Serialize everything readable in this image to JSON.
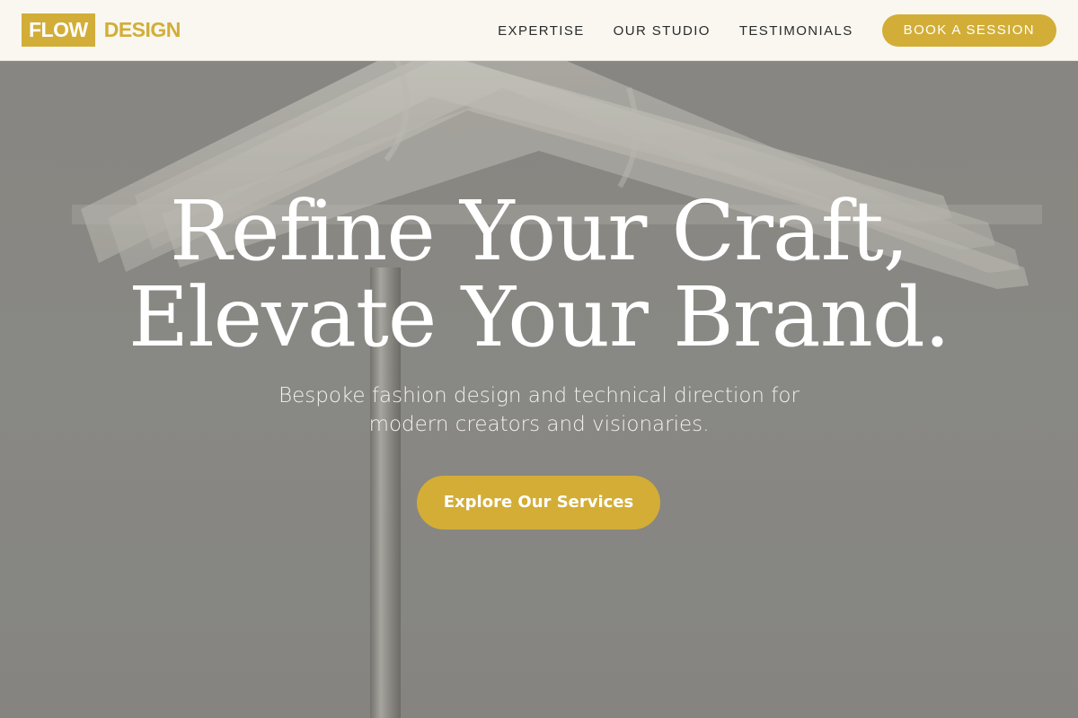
{
  "brand": {
    "box_text": "FLOW",
    "text": "DESIGN",
    "accent_color": "#d2ae38"
  },
  "nav": {
    "links": [
      "EXPERTISE",
      "OUR STUDIO",
      "TESTIMONIALS"
    ],
    "cta_label": "BOOK A SESSION"
  },
  "hero": {
    "headline_line1": "Refine Your Craft,",
    "headline_line2": "Elevate Your Brand.",
    "subtitle_line1": "Bespoke fashion design and technical direction for",
    "subtitle_line2": "modern creators and visionaries.",
    "cta_label": "Explore Our Services",
    "background_image": "white-hangers-on-rack"
  }
}
